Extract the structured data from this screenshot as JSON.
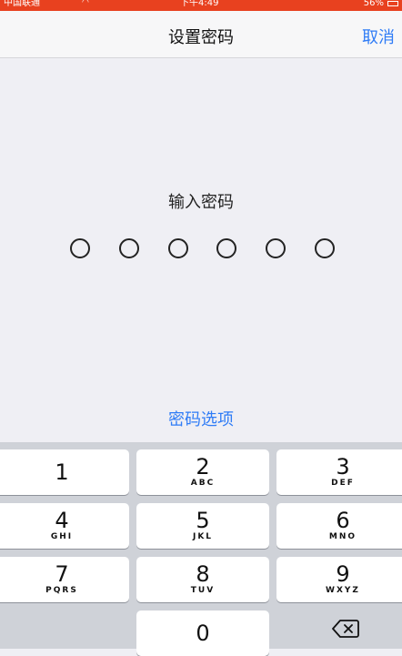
{
  "status_bar": {
    "carrier": "中国联通",
    "time": "下午4:49",
    "battery": "56%"
  },
  "nav": {
    "title": "设置密码",
    "cancel_label": "取消"
  },
  "prompt": "输入密码",
  "passcode_length": 6,
  "options_link": "密码选项",
  "keypad": {
    "keys": [
      {
        "digit": "1",
        "letters": ""
      },
      {
        "digit": "2",
        "letters": "ABC"
      },
      {
        "digit": "3",
        "letters": "DEF"
      },
      {
        "digit": "4",
        "letters": "GHI"
      },
      {
        "digit": "5",
        "letters": "JKL"
      },
      {
        "digit": "6",
        "letters": "MNO"
      },
      {
        "digit": "7",
        "letters": "PQRS"
      },
      {
        "digit": "8",
        "letters": "TUV"
      },
      {
        "digit": "9",
        "letters": "WXYZ"
      },
      {
        "digit": "0",
        "letters": ""
      }
    ]
  },
  "colors": {
    "accent": "#2f7cf6",
    "status_bar": "#e8411f",
    "background": "#efeff4",
    "keyboard": "#cfd2d8"
  }
}
